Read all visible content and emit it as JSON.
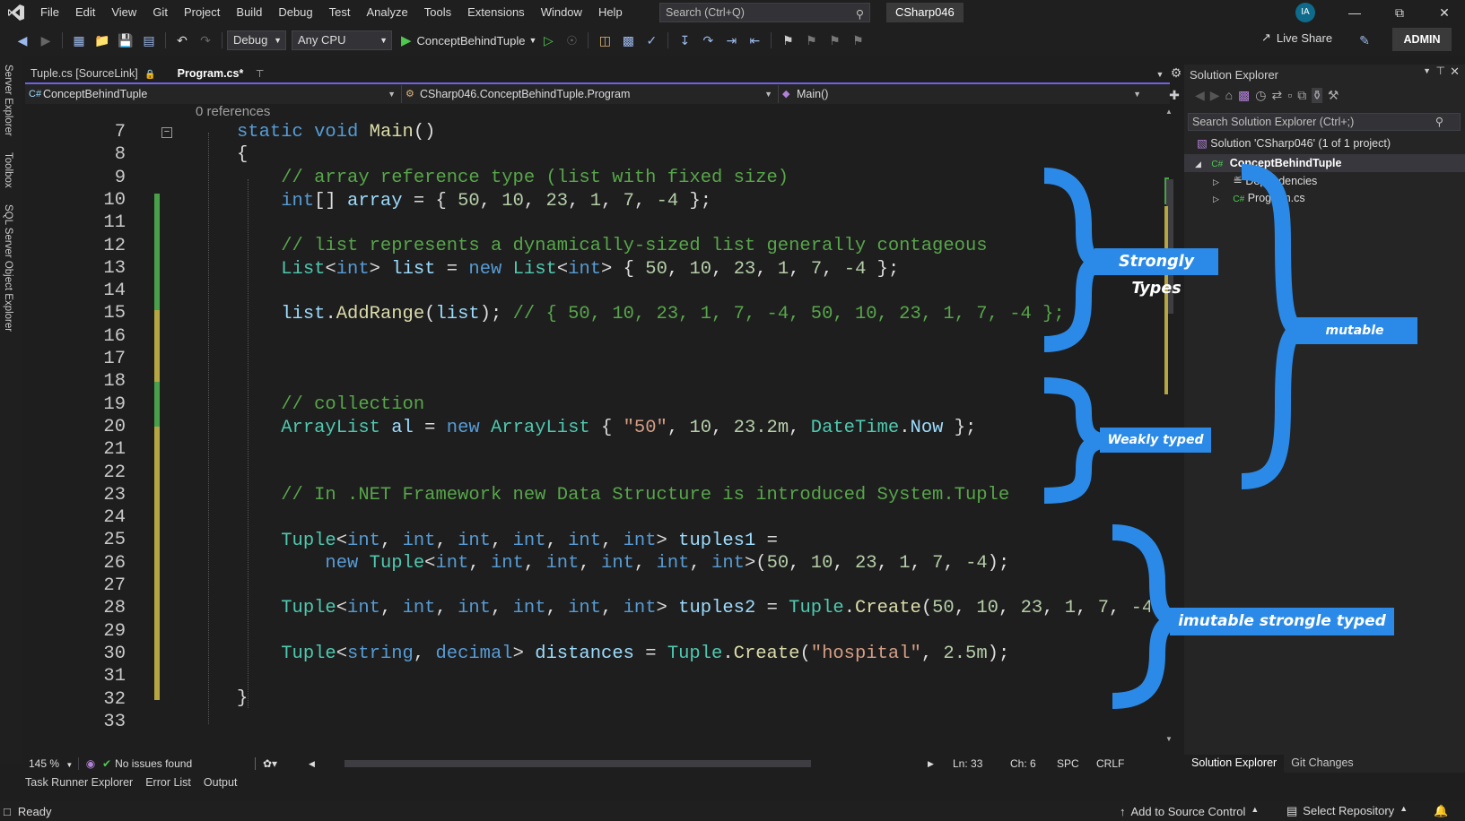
{
  "menubar": {
    "items": [
      "File",
      "Edit",
      "View",
      "Git",
      "Project",
      "Build",
      "Debug",
      "Test",
      "Analyze",
      "Tools",
      "Extensions",
      "Window",
      "Help"
    ],
    "search_placeholder": "Search (Ctrl+Q)",
    "solution_name": "CSharp046",
    "avatar_initials": "IA"
  },
  "toolbar": {
    "config": "Debug",
    "platform": "Any CPU",
    "startup_project": "ConceptBehindTuple",
    "live_share": "Live Share",
    "admin": "ADMIN"
  },
  "left_strip": [
    "Server Explorer",
    "Toolbox",
    "SQL Server Object Explorer"
  ],
  "tabs": [
    {
      "label": "Tuple.cs [SourceLink]",
      "active": false
    },
    {
      "label": "Program.cs*",
      "active": true
    }
  ],
  "navbar": {
    "project": "ConceptBehindTuple",
    "class": "CSharp046.ConceptBehindTuple.Program",
    "member": "Main()"
  },
  "editor": {
    "references": "0 references",
    "line_numbers": [
      "7",
      "8",
      "9",
      "10",
      "11",
      "12",
      "13",
      "14",
      "15",
      "16",
      "17",
      "18",
      "19",
      "20",
      "21",
      "22",
      "23",
      "24",
      "25",
      "26",
      "27",
      "28",
      "29",
      "30",
      "31",
      "32",
      "33"
    ],
    "zoom": "145 %",
    "issues": "No issues found",
    "ln": "Ln: 33",
    "ch": "Ch: 6",
    "spc": "SPC",
    "crlf": "CRLF"
  },
  "bottom_tabs": [
    "Task Runner Explorer",
    "Error List",
    "Output"
  ],
  "status": {
    "ready": "Ready",
    "add_source": "Add to Source Control",
    "select_repo": "Select Repository"
  },
  "solution_explorer": {
    "title": "Solution Explorer",
    "search_placeholder": "Search Solution Explorer (Ctrl+;)",
    "solution": "Solution 'CSharp046' (1 of 1 project)",
    "project": "ConceptBehindTuple",
    "dependencies": "Dependencies",
    "program": "Program.cs",
    "bottom_tabs": [
      "Solution Explorer",
      "Git Changes"
    ]
  },
  "annotations": {
    "strongly": "Strongly Types",
    "weakly": "Weakly typed",
    "mutable": "mutable",
    "immutable": "imutable strongle typed",
    "accent": "#2b8ae8"
  }
}
